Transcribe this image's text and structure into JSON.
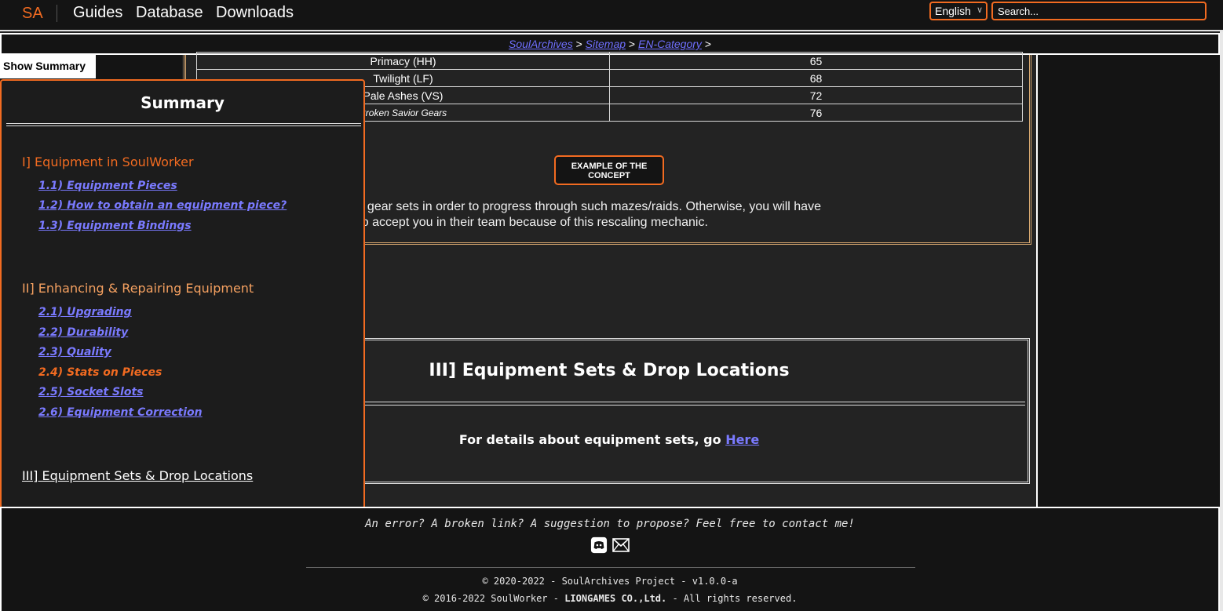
{
  "nav": {
    "logo": "SA",
    "links": [
      "Guides",
      "Database",
      "Downloads"
    ],
    "language": "English",
    "search_placeholder": "Search..."
  },
  "breadcrumb": {
    "items": [
      "SoulArchives",
      "Sitemap",
      "EN-Category"
    ],
    "separator": ">"
  },
  "stats_table": {
    "rows": [
      {
        "name": "Primacy (HH)",
        "value": "65"
      },
      {
        "name": "Twilight (LF)",
        "value": "68"
      },
      {
        "name": "Pale Ashes (VS)",
        "value": "72"
      },
      {
        "name": "Broken Savior Gears",
        "value": "76"
      }
    ]
  },
  "example_button": {
    "line1": "EXAMPLE OF THE",
    "line2": "CONCEPT"
  },
  "paragraph": {
    "line1": "better focusing on higher level gear sets in order to progress through such mazes/raids. Otherwise, you will have",
    "line2": "raids or to find people willing to accept you in their team because of this rescaling mechanic."
  },
  "section3": {
    "title": "III] Equipment Sets & Drop Locations",
    "text": "For details about equipment sets, go ",
    "link": "Here"
  },
  "summary": {
    "toggle_label": "Show Summary",
    "title": "Summary",
    "sections": [
      {
        "heading": "I] Equipment in SoulWorker",
        "links": [
          "1.1) Equipment Pieces",
          "1.2) How to obtain an equipment piece?",
          "1.3) Equipment Bindings"
        ]
      },
      {
        "heading": "II] Enhancing & Repairing Equipment",
        "links": [
          "2.1) Upgrading",
          "2.2) Durability",
          "2.3) Quality",
          "2.4) Stats on Pieces",
          "2.5) Socket Slots",
          "2.6) Equipment Correction"
        ]
      },
      {
        "heading": "III] Equipment Sets & Drop Locations",
        "links": []
      }
    ],
    "active_link": "2.4) Stats on Pieces"
  },
  "footer": {
    "message": "An error? A broken link? A suggestion to propose? Feel free to contact me!",
    "icons": [
      "discord-icon",
      "mail-icon"
    ],
    "copyright1": "© 2020-2022 - SoulArchives Project - v1.0.0-a",
    "copyright2_prefix": "© 2016-2022 SoulWorker - ",
    "copyright2_company": "LIONGAMES CO.,Ltd.",
    "copyright2_suffix": " - All rights reserved."
  },
  "colors": {
    "accent": "#f26b21",
    "link": "#7a7aff",
    "background": "#232323",
    "panel": "#141414"
  }
}
